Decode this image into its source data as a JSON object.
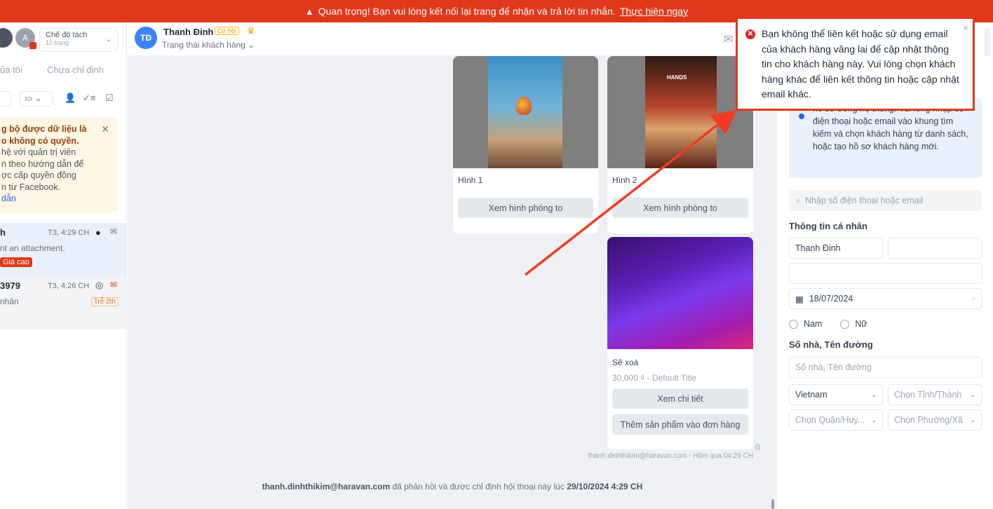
{
  "banner": {
    "icon": "warning-triangle-icon",
    "text": "Quan trọng! Bạn vui lòng kết nối lại trang để nhận và trả lời tin nhắn.",
    "link": "Thực hiện ngay"
  },
  "sidebar": {
    "avatar_letter": "A",
    "mode": {
      "label": "Chế độ tách",
      "sub": "10 trang"
    },
    "tabs": [
      "ủa tôi",
      "Chưa chỉ định"
    ],
    "notice": {
      "title": "g bộ được dữ liệu là\no không có quyền.",
      "body": "hệ với quản trị viên\nn theo hướng dẫn để\nợc cấp quyền đồng\nn từ Facebook.",
      "link": "dẫn"
    },
    "conversations": [
      {
        "name": "h",
        "time": "T3, 4:29 CH",
        "message": "nt an attachment.",
        "tag": "Giá cao"
      },
      {
        "name": "3979",
        "time": "T3, 4:26 CH",
        "message": "nhân",
        "tag": "Trễ 2th"
      }
    ]
  },
  "chat_header": {
    "avatar_initials": "TĐ",
    "name": "Thanh Đinh",
    "stage_badge": "Cơ hội",
    "status_select": "Trạng thái khách hàng"
  },
  "cards": [
    {
      "title": "Hình 1",
      "button": "Xem hình phóng to"
    },
    {
      "title": "Hình 2",
      "button": "Xem hình phóng to",
      "shop_sign": "HANDS"
    },
    {
      "title": "Sẽ xoá",
      "price": "30,000 ₫ - Default Title",
      "buttons": [
        "Xem chi tiết",
        "Thêm sản phẩm vào đơn hàng"
      ]
    }
  ],
  "chat": {
    "meta": "thanh.dinhthikim@haravan.com - Hôm qua 04:29 CH",
    "assign_email": "thanh.dinhthikim@haravan.com",
    "assign_text": " đã phản hồi và được chỉ định hội thoại này lúc ",
    "assign_time": "29/10/2024 4:29 CH"
  },
  "right_panel": {
    "info_text": "hồ sơ trong hệ thống. Vui lòng nhập số điện thoại hoặc email vào khung tìm kiếm và chọn khách hàng từ danh sách, hoặc tạo hồ sơ khách hàng mới.",
    "search_placeholder": "Nhập số điện thoại hoặc email",
    "personal_label": "Thông tin cá nhân",
    "first_name": "Thanh Đinh",
    "birthday": "18/07/2024",
    "gender_male": "Nam",
    "gender_female": "Nữ",
    "address_label": "Số nhà, Tên đường",
    "address_placeholder": "Số nhà, Tên đường",
    "country": "Vietnam",
    "province_placeholder": "Chọn Tỉnh/Thành",
    "district_placeholder": "Chọn Quận/Huy...",
    "ward_placeholder": "Chọn Phường/Xã"
  },
  "toast": {
    "icon": "error-circle-icon",
    "message": "Bạn không thể liên kết hoặc sử dụng email của khách hàng vãng lai để cập nhật thông tin cho khách hàng này. Vui lòng chọn khách hàng khác để liên kết thông tin hoặc cập nhật email khác.",
    "close": "×"
  },
  "colors": {
    "accent": "#e0381c",
    "primary": "#3b82f6"
  }
}
